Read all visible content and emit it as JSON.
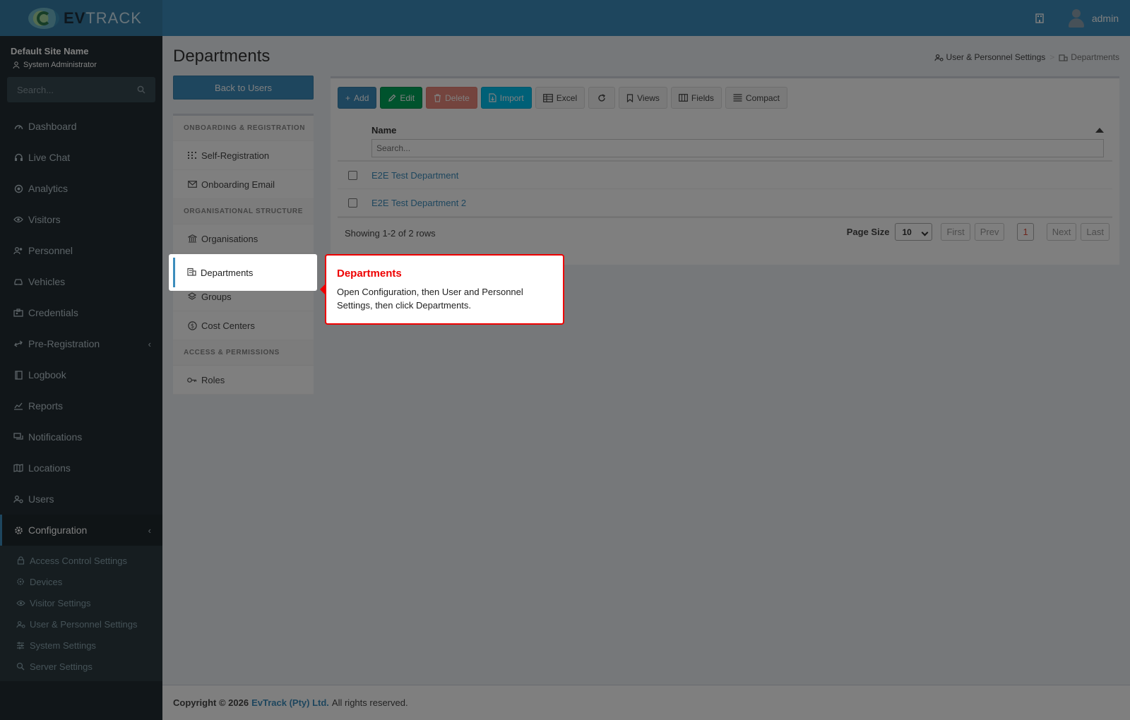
{
  "brand": {
    "name_bold": "EV",
    "name_light": "TRACK"
  },
  "header": {
    "user_name": "admin"
  },
  "sidebar": {
    "site_name": "Default Site Name",
    "role": "System Administrator",
    "search_placeholder": "Search...",
    "items": [
      {
        "label": "Dashboard",
        "icon": "dashboard-icon"
      },
      {
        "label": "Live Chat",
        "icon": "headset-icon"
      },
      {
        "label": "Analytics",
        "icon": "target-icon"
      },
      {
        "label": "Visitors",
        "icon": "eye-icon"
      },
      {
        "label": "Personnel",
        "icon": "users-icon"
      },
      {
        "label": "Vehicles",
        "icon": "car-icon"
      },
      {
        "label": "Credentials",
        "icon": "id-card-icon"
      },
      {
        "label": "Pre-Registration",
        "icon": "arrows-icon"
      },
      {
        "label": "Logbook",
        "icon": "book-icon"
      },
      {
        "label": "Reports",
        "icon": "chart-icon"
      },
      {
        "label": "Notifications",
        "icon": "chat-icon"
      },
      {
        "label": "Locations",
        "icon": "map-icon"
      },
      {
        "label": "Users",
        "icon": "user-cog-icon"
      },
      {
        "label": "Configuration",
        "icon": "gear-icon"
      }
    ],
    "config_submenu": [
      {
        "label": "Access Control Settings",
        "icon": "lock-icon"
      },
      {
        "label": "Devices",
        "icon": "device-icon"
      },
      {
        "label": "Visitor Settings",
        "icon": "eye-icon"
      },
      {
        "label": "User & Personnel Settings",
        "icon": "user-cog-icon"
      },
      {
        "label": "System Settings",
        "icon": "sliders-icon"
      },
      {
        "label": "Server Settings",
        "icon": "server-icon"
      }
    ]
  },
  "page": {
    "title": "Departments",
    "breadcrumb": {
      "parent": "User & Personnel Settings",
      "separator": ">",
      "current": "Departments"
    },
    "back_button": "Back to Users"
  },
  "settings_nav": {
    "sections": [
      {
        "header": "ONBOARDING & REGISTRATION",
        "items": [
          "Self-Registration",
          "Onboarding Email"
        ]
      },
      {
        "header": "ORGANISATIONAL STRUCTURE",
        "items": [
          "Organisations",
          "Departments",
          "Groups",
          "Cost Centers"
        ]
      },
      {
        "header": "ACCESS & PERMISSIONS",
        "items": [
          "Roles"
        ]
      }
    ]
  },
  "toolbar": {
    "add": "Add",
    "edit": "Edit",
    "delete": "Delete",
    "import": "Import",
    "excel": "Excel",
    "views": "Views",
    "fields": "Fields",
    "compact": "Compact"
  },
  "grid": {
    "column": "Name",
    "filter_placeholder": "Search...",
    "rows": [
      "E2E Test Department",
      "E2E Test Department 2"
    ],
    "showing": "Showing 1-2 of 2 rows",
    "page_size_label": "Page Size",
    "page_size": "10",
    "pager": {
      "first": "First",
      "prev": "Prev",
      "current": "1",
      "next": "Next",
      "last": "Last"
    }
  },
  "footer": {
    "copyright": "Copyright © 2026",
    "company": "EvTrack (Pty) Ltd.",
    "rights": "All rights reserved."
  },
  "tour": {
    "title": "Departments",
    "body": "Open Configuration, then User and Personnel Settings, then click Departments."
  },
  "colors": {
    "primary": "#3c8dbc",
    "sidebar": "#222d32",
    "success": "#00a65a",
    "danger": "#dd4b39",
    "info": "#00c0ef",
    "tour_border": "#e00000"
  }
}
